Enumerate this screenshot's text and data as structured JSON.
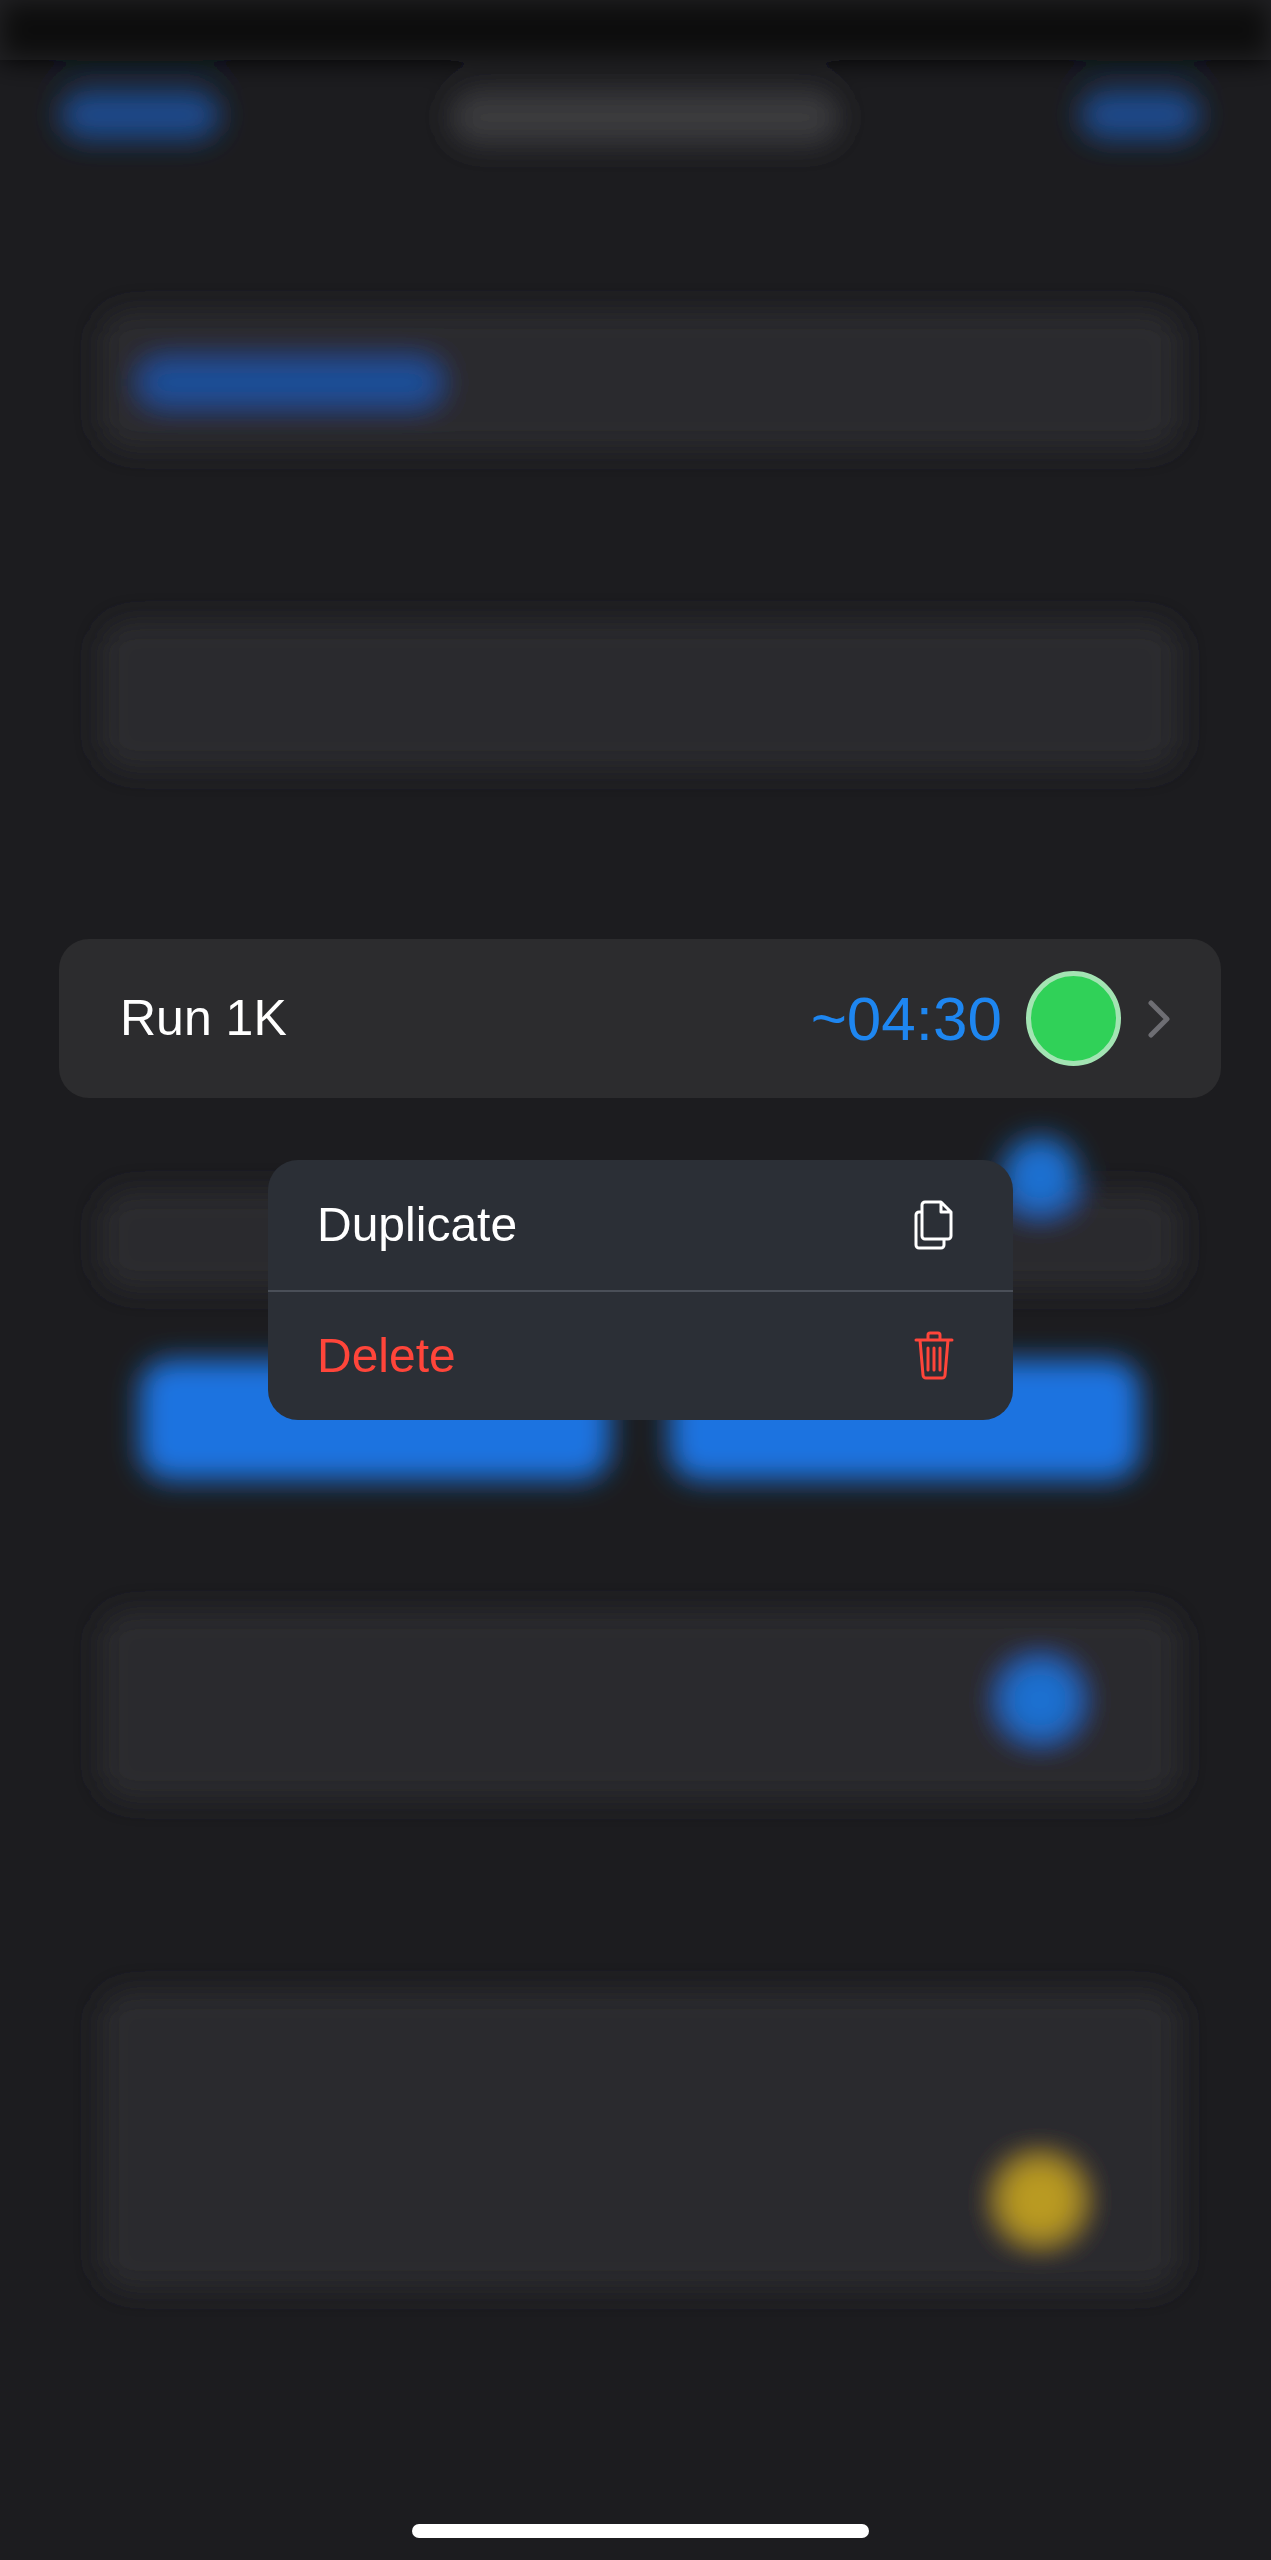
{
  "row": {
    "title": "Run 1K",
    "time": "~04:30"
  },
  "menu": [
    {
      "label": "Duplicate",
      "kind": "normal"
    },
    {
      "label": "Delete",
      "kind": "destructive"
    }
  ]
}
